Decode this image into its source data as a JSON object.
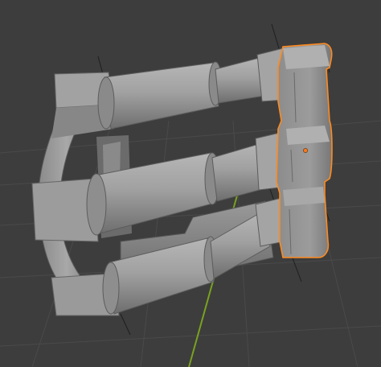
{
  "viewport": {
    "mode": "solid-shading",
    "background_color": "#3d3d3d",
    "grid_color": "#4a4a4a",
    "y_axis_color": "#7aa11f",
    "object_color": "#9a9a9a",
    "selection_color": "#ff8a1f",
    "origin_color": "#ff7a1a"
  },
  "scene": {
    "object": "mechanical-part",
    "arms_count": 3,
    "selected": true
  }
}
